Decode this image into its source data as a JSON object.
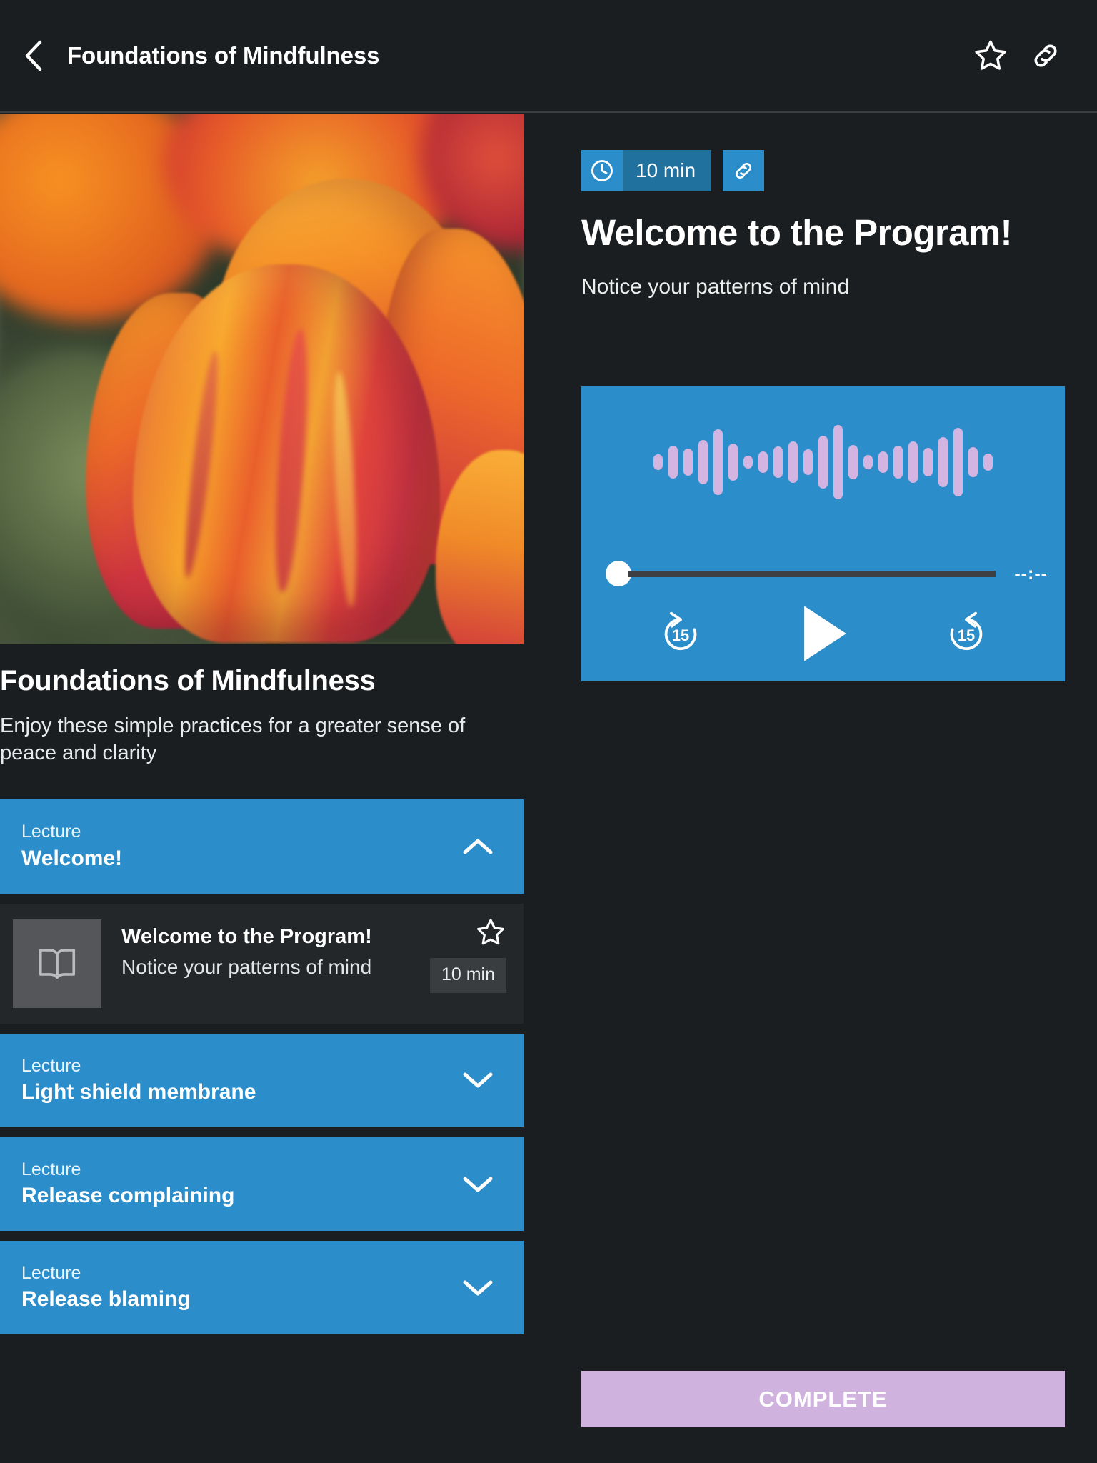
{
  "appbar": {
    "back_icon": "chevron-left-icon",
    "title": "Foundations of Mindfulness",
    "favorite_icon": "star-outline-icon",
    "share_icon": "link-icon"
  },
  "course": {
    "hero_image_alt": "orange tulip close-up",
    "title": "Foundations of Mindfulness",
    "subtitle": "Enjoy these simple practices for a greater sense of peace and clarity"
  },
  "sections": [
    {
      "kicker": "Lecture",
      "name": "Welcome!",
      "expanded": true,
      "chevron": "chevron-up-icon",
      "lessons": [
        {
          "icon": "book-icon",
          "title": "Welcome to the Program!",
          "subtitle": "Notice your patterns of mind",
          "favorite_icon": "star-outline-icon",
          "duration": "10 min"
        }
      ]
    },
    {
      "kicker": "Lecture",
      "name": "Light shield membrane",
      "expanded": false,
      "chevron": "chevron-down-icon",
      "lessons": []
    },
    {
      "kicker": "Lecture",
      "name": "Release complaining",
      "expanded": false,
      "chevron": "chevron-down-icon",
      "lessons": []
    },
    {
      "kicker": "Lecture",
      "name": "Release blaming",
      "expanded": false,
      "chevron": "chevron-down-icon",
      "lessons": []
    }
  ],
  "detail": {
    "duration": "10 min",
    "clock_icon": "clock-icon",
    "link_icon": "link-icon",
    "title": "Welcome to the Program!",
    "description": "Notice your patterns of mind"
  },
  "player": {
    "waveform": [
      22,
      46,
      38,
      62,
      92,
      52,
      18,
      30,
      44,
      58,
      36,
      74,
      104,
      48,
      20,
      30,
      46,
      58,
      40,
      70,
      96,
      42,
      24
    ],
    "waveform_color": "#d4b4e0",
    "progress_percent": 0,
    "time_display": "--:--",
    "rewind_label": "15",
    "rewind_icon": "replay-15-icon",
    "play_icon": "play-icon",
    "forward_label": "15",
    "forward_icon": "forward-15-icon",
    "background_color": "#2b8dc9"
  },
  "complete": {
    "label": "COMPLETE",
    "color": "#cfb2de"
  }
}
